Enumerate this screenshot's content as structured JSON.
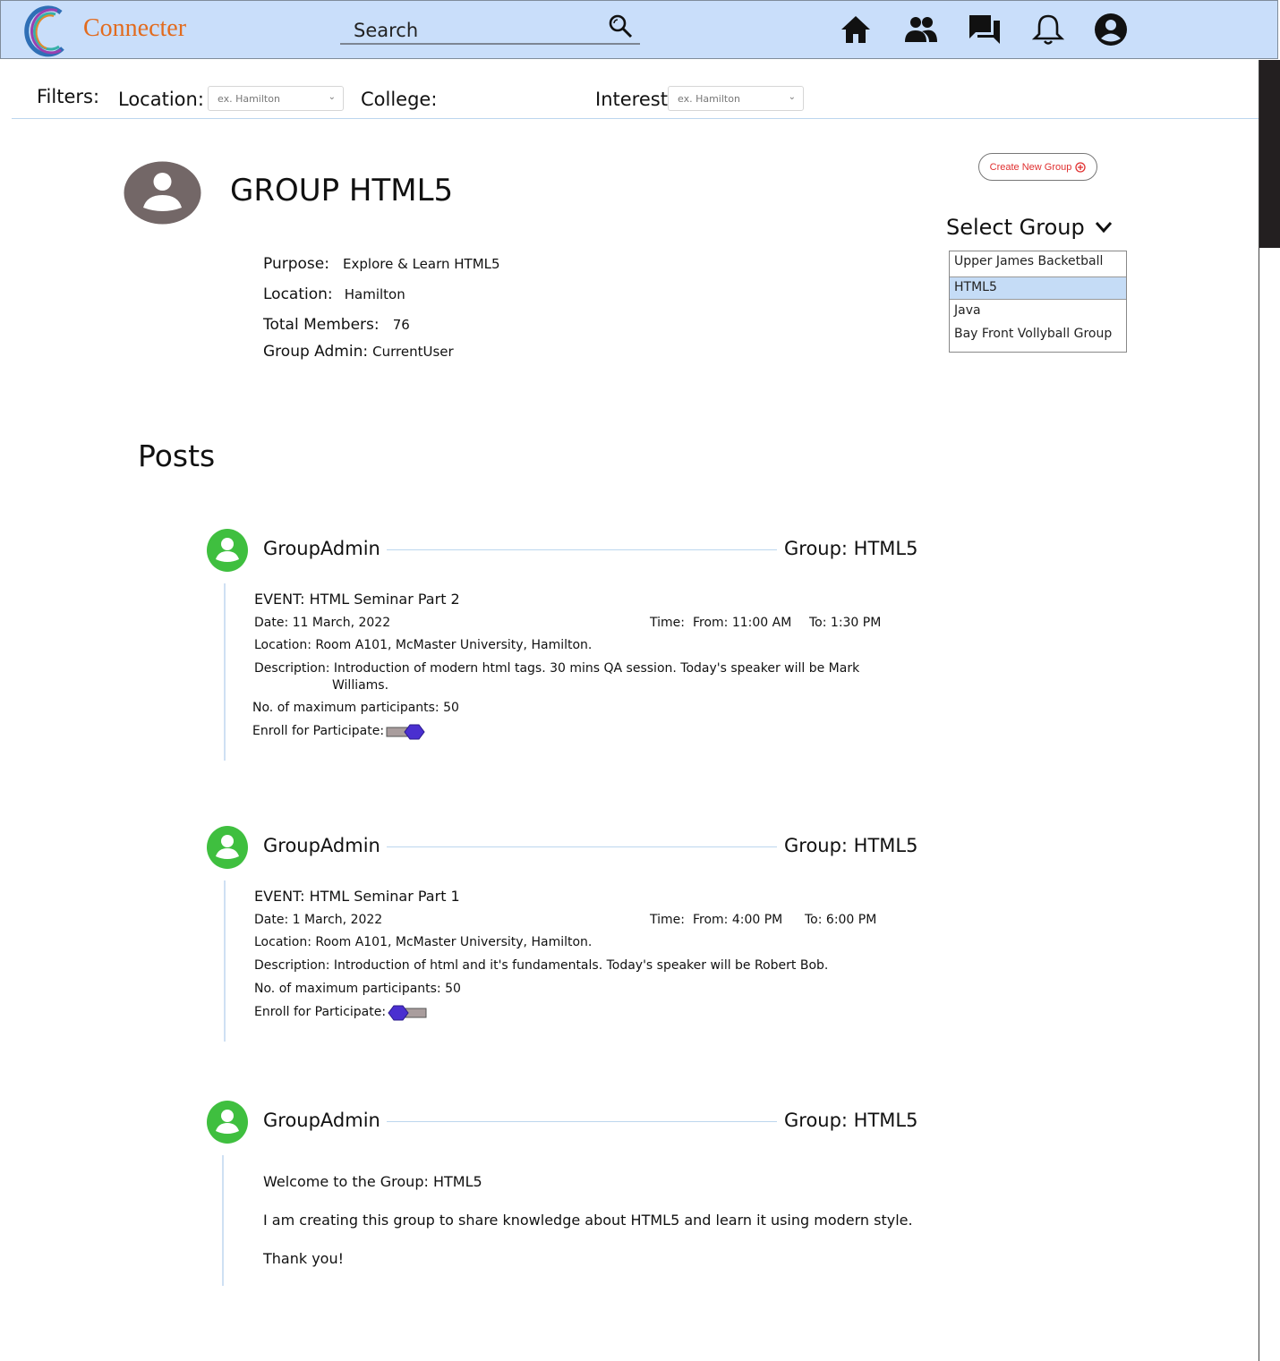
{
  "app": {
    "brand": "Connecter"
  },
  "search": {
    "placeholder": "Search"
  },
  "nav": {
    "icons": [
      "home-icon",
      "people-icon",
      "chat-icon",
      "bell-icon",
      "account-icon"
    ]
  },
  "filters": {
    "label": "Filters:",
    "location_label": "Location:",
    "location_placeholder": "ex. Hamilton",
    "college_label": "College:",
    "interest_label": "Interest:",
    "interest_placeholder": "ex. Hamilton"
  },
  "group": {
    "title": "GROUP HTML5",
    "purpose_label": "Purpose:",
    "purpose": "Explore & Learn HTML5",
    "location_label": "Location:",
    "location": "Hamilton",
    "members_label": "Total Members:",
    "members": "76",
    "admin_label": "Group Admin:",
    "admin": "CurrentUser"
  },
  "sidebar": {
    "create_label": "Create New Group",
    "select_label": "Select Group",
    "groups": [
      "Upper James Backetball",
      "HTML5",
      "Java",
      "Bay Front Vollyball Group"
    ],
    "selected_index": 1
  },
  "posts_title": "Posts",
  "posts": [
    {
      "author": "GroupAdmin",
      "group": "Group: HTML5",
      "event": "EVENT: HTML Seminar Part 2",
      "date": "Date: 11 March, 2022",
      "time_label": "Time:",
      "from": "From: 11:00 AM",
      "to": "To: 1:30 PM",
      "location": "Location: Room A101, McMaster University, Hamilton.",
      "description_1": "Description: Introduction of modern html tags. 30 mins QA session. Today's speaker will be Mark",
      "description_2": "Williams.",
      "max": "No. of maximum participants: 50",
      "enroll": "Enroll for Participate:",
      "enrolled": true
    },
    {
      "author": "GroupAdmin",
      "group": "Group: HTML5",
      "event": "EVENT: HTML Seminar Part 1",
      "date": "Date: 1 March, 2022",
      "time_label": "Time:",
      "from": "From: 4:00 PM",
      "to": "To: 6:00 PM",
      "location": "Location: Room A101, McMaster University, Hamilton.",
      "description": "Description: Introduction of html and it's fundamentals. Today's speaker will be Robert Bob.",
      "max": "No. of maximum participants: 50",
      "enroll": "Enroll for Participate:",
      "enrolled": false
    },
    {
      "author": "GroupAdmin",
      "group": "Group: HTML5",
      "line_1": "Welcome to the Group: HTML5",
      "line_2": "I am creating this group to share knowledge about HTML5 and learn it using modern style.",
      "line_3": "Thank you!"
    }
  ],
  "colors": {
    "topbar": "#c9defa",
    "brand": "#e26b1e",
    "avatar_green": "#3fbf3f",
    "toggle_knob": "#4a2fd0",
    "create": "#e03030"
  }
}
